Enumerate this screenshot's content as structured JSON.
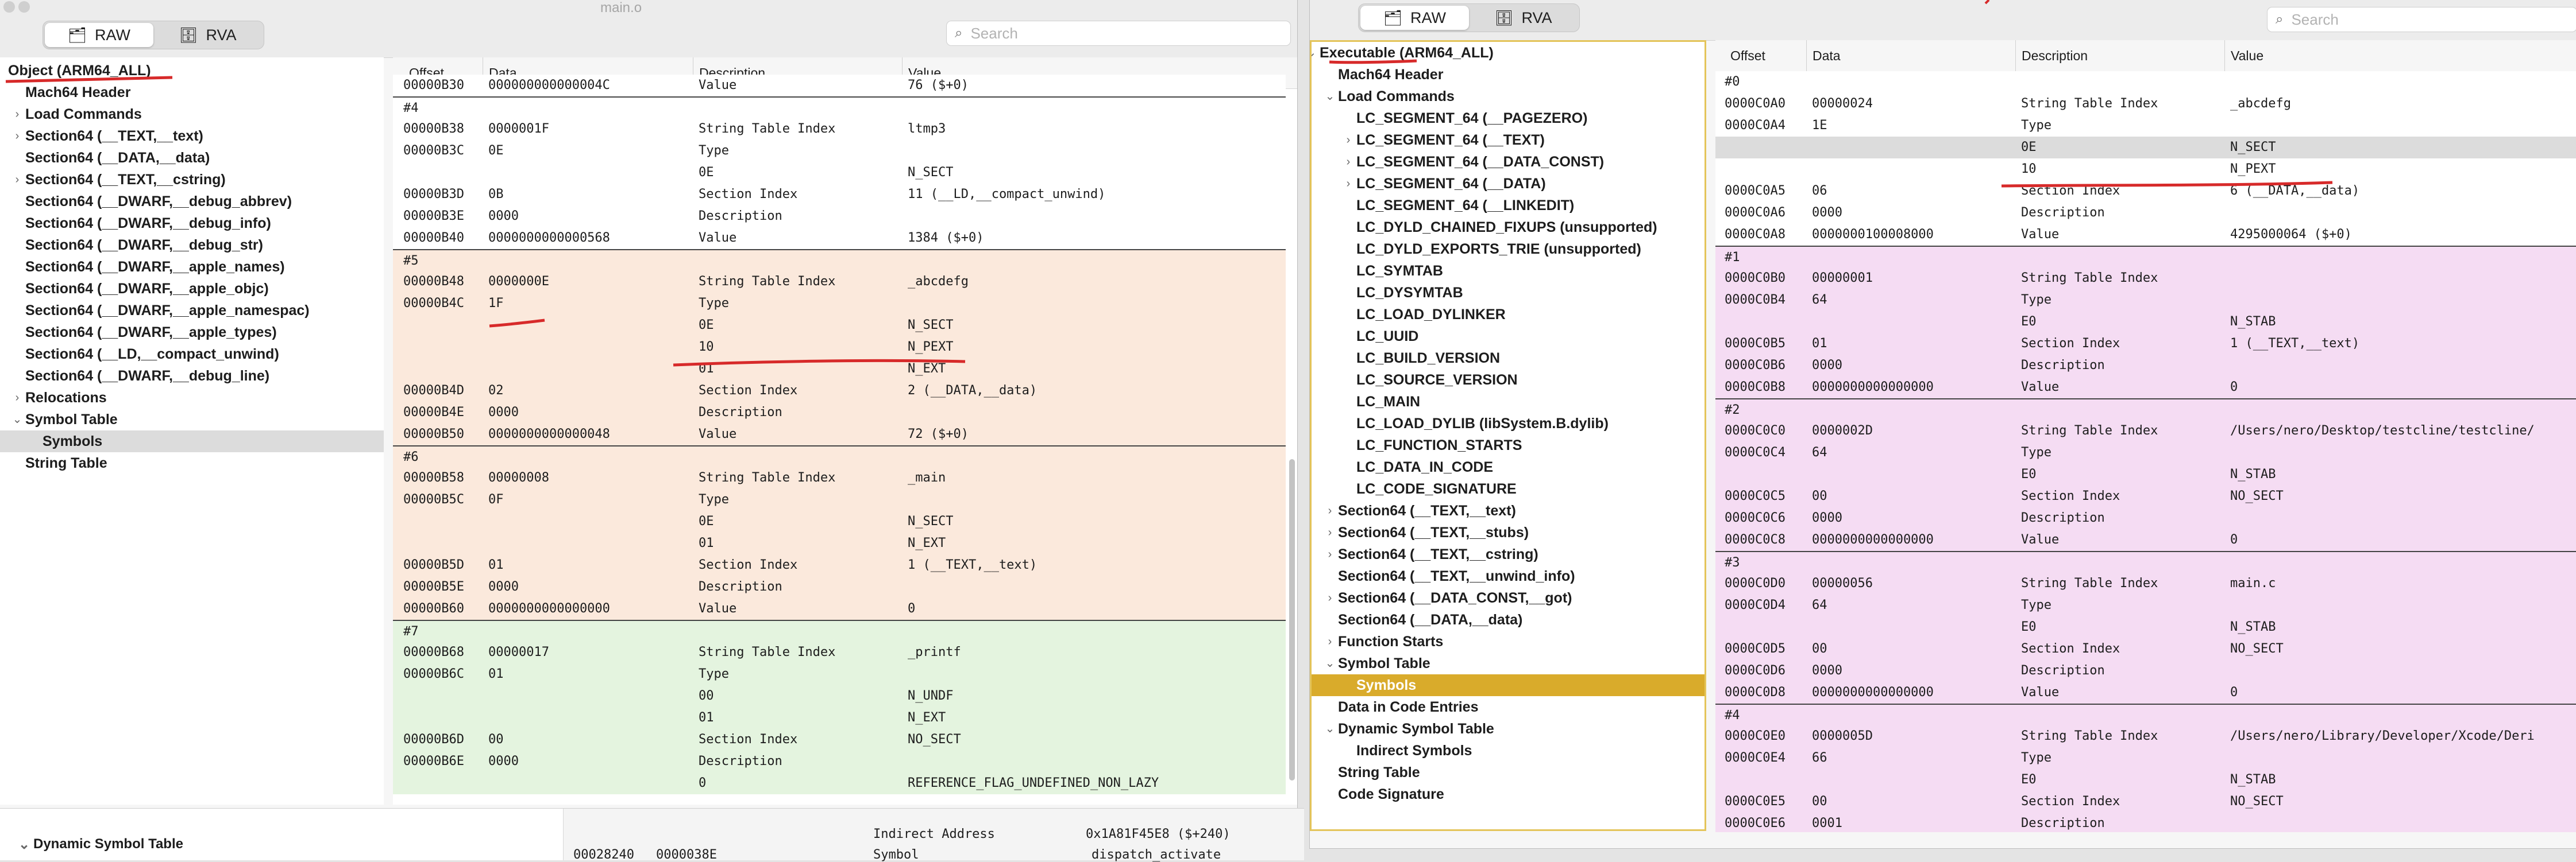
{
  "left_window": {
    "title": "main.o",
    "seg_raw": "RAW",
    "seg_rva": "RVA",
    "search_placeholder": "Search",
    "columns": {
      "offset": "Offset",
      "data": "Data",
      "description": "Description",
      "value": "Value"
    },
    "tree": [
      {
        "label": "Object (ARM64_ALL)",
        "level": 0,
        "arrow": ""
      },
      {
        "label": "Mach64 Header",
        "level": 1,
        "arrow": ""
      },
      {
        "label": "Load Commands",
        "level": 1,
        "arrow": "›"
      },
      {
        "label": "Section64 (__TEXT,__text)",
        "level": 1,
        "arrow": "›"
      },
      {
        "label": "Section64 (__DATA,__data)",
        "level": 1,
        "arrow": ""
      },
      {
        "label": "Section64 (__TEXT,__cstring)",
        "level": 1,
        "arrow": "›"
      },
      {
        "label": "Section64 (__DWARF,__debug_abbrev)",
        "level": 1,
        "arrow": ""
      },
      {
        "label": "Section64 (__DWARF,__debug_info)",
        "level": 1,
        "arrow": ""
      },
      {
        "label": "Section64 (__DWARF,__debug_str)",
        "level": 1,
        "arrow": ""
      },
      {
        "label": "Section64 (__DWARF,__apple_names)",
        "level": 1,
        "arrow": ""
      },
      {
        "label": "Section64 (__DWARF,__apple_objc)",
        "level": 1,
        "arrow": ""
      },
      {
        "label": "Section64 (__DWARF,__apple_namespac)",
        "level": 1,
        "arrow": ""
      },
      {
        "label": "Section64 (__DWARF,__apple_types)",
        "level": 1,
        "arrow": ""
      },
      {
        "label": "Section64 (__LD,__compact_unwind)",
        "level": 1,
        "arrow": ""
      },
      {
        "label": "Section64 (__DWARF,__debug_line)",
        "level": 1,
        "arrow": ""
      },
      {
        "label": "Relocations",
        "level": 1,
        "arrow": "›"
      },
      {
        "label": "Symbol Table",
        "level": 1,
        "arrow": "⌄"
      },
      {
        "label": "Symbols",
        "level": 2,
        "arrow": "",
        "selected": true
      },
      {
        "label": "String Table",
        "level": 1,
        "arrow": ""
      }
    ],
    "rows": [
      {
        "offset": "00000B30",
        "data": "000000000000004C",
        "desc": "Value",
        "value": "76 ($+0)",
        "bg": "white",
        "clip": true
      },
      {
        "offset": "#4",
        "data": "",
        "desc": "",
        "value": "",
        "bg": "white",
        "divider": true
      },
      {
        "offset": "00000B38",
        "data": "0000001F",
        "desc": "String Table Index",
        "value": "ltmp3",
        "bg": "white"
      },
      {
        "offset": "00000B3C",
        "data": "0E",
        "desc": "Type",
        "value": "",
        "bg": "white"
      },
      {
        "offset": "",
        "data": "",
        "desc": "0E",
        "value": "N_SECT",
        "bg": "white"
      },
      {
        "offset": "00000B3D",
        "data": "0B",
        "desc": "Section Index",
        "value": "11 (__LD,__compact_unwind)",
        "bg": "white"
      },
      {
        "offset": "00000B3E",
        "data": "0000",
        "desc": "Description",
        "value": "",
        "bg": "white"
      },
      {
        "offset": "00000B40",
        "data": "0000000000000568",
        "desc": "Value",
        "value": "1384 ($+0)",
        "bg": "white"
      },
      {
        "offset": "#5",
        "data": "",
        "desc": "",
        "value": "",
        "bg": "peach",
        "divider": true
      },
      {
        "offset": "00000B48",
        "data": "0000000E",
        "desc": "String Table Index",
        "value": "_abcdefg",
        "bg": "peach"
      },
      {
        "offset": "00000B4C",
        "data": "1F",
        "desc": "Type",
        "value": "",
        "bg": "peach"
      },
      {
        "offset": "",
        "data": "",
        "desc": "0E",
        "value": "N_SECT",
        "bg": "peach"
      },
      {
        "offset": "",
        "data": "",
        "desc": "10",
        "value": "N_PEXT",
        "bg": "peach"
      },
      {
        "offset": "",
        "data": "",
        "desc": "01",
        "value": "N_EXT",
        "bg": "peach"
      },
      {
        "offset": "00000B4D",
        "data": "02",
        "desc": "Section Index",
        "value": "2 (__DATA,__data)",
        "bg": "peach"
      },
      {
        "offset": "00000B4E",
        "data": "0000",
        "desc": "Description",
        "value": "",
        "bg": "peach"
      },
      {
        "offset": "00000B50",
        "data": "0000000000000048",
        "desc": "Value",
        "value": "72 ($+0)",
        "bg": "peach"
      },
      {
        "offset": "#6",
        "data": "",
        "desc": "",
        "value": "",
        "bg": "peach",
        "divider": true
      },
      {
        "offset": "00000B58",
        "data": "00000008",
        "desc": "String Table Index",
        "value": "_main",
        "bg": "peach"
      },
      {
        "offset": "00000B5C",
        "data": "0F",
        "desc": "Type",
        "value": "",
        "bg": "peach"
      },
      {
        "offset": "",
        "data": "",
        "desc": "0E",
        "value": "N_SECT",
        "bg": "peach"
      },
      {
        "offset": "",
        "data": "",
        "desc": "01",
        "value": "N_EXT",
        "bg": "peach"
      },
      {
        "offset": "00000B5D",
        "data": "01",
        "desc": "Section Index",
        "value": "1 (__TEXT,__text)",
        "bg": "peach"
      },
      {
        "offset": "00000B5E",
        "data": "0000",
        "desc": "Description",
        "value": "",
        "bg": "peach"
      },
      {
        "offset": "00000B60",
        "data": "0000000000000000",
        "desc": "Value",
        "value": "0",
        "bg": "peach"
      },
      {
        "offset": "#7",
        "data": "",
        "desc": "",
        "value": "",
        "bg": "green",
        "divider": true
      },
      {
        "offset": "00000B68",
        "data": "00000017",
        "desc": "String Table Index",
        "value": "_printf",
        "bg": "green"
      },
      {
        "offset": "00000B6C",
        "data": "01",
        "desc": "Type",
        "value": "",
        "bg": "green"
      },
      {
        "offset": "",
        "data": "",
        "desc": "00",
        "value": "N_UNDF",
        "bg": "green"
      },
      {
        "offset": "",
        "data": "",
        "desc": "01",
        "value": "N_EXT",
        "bg": "green"
      },
      {
        "offset": "00000B6D",
        "data": "00",
        "desc": "Section Index",
        "value": "NO_SECT",
        "bg": "green"
      },
      {
        "offset": "00000B6E",
        "data": "0000",
        "desc": "Description",
        "value": "",
        "bg": "green"
      },
      {
        "offset": "",
        "data": "",
        "desc": "0",
        "value": "REFERENCE_FLAG_UNDEFINED_NON_LAZY",
        "bg": "green"
      }
    ]
  },
  "background_strip": {
    "tree_label": "Dynamic Symbol Table",
    "row1_desc": "Indirect Address",
    "row1_value": "0x1A81F45E8 ($+240)",
    "row2_offset": "00028240",
    "row2_data": "0000038E",
    "row2_desc": "Symbol",
    "row2_value": "dispatch_activate"
  },
  "right_window": {
    "seg_raw": "RAW",
    "seg_rva": "RVA",
    "search_placeholder": "Search",
    "columns": {
      "offset": "Offset",
      "data": "Data",
      "description": "Description",
      "value": "Value"
    },
    "tree": [
      {
        "label": "Executable (ARM64_ALL)",
        "level": 0,
        "arrow": "⌄"
      },
      {
        "label": "Mach64 Header",
        "level": 1,
        "arrow": ""
      },
      {
        "label": "Load Commands",
        "level": 1,
        "arrow": "⌄"
      },
      {
        "label": "LC_SEGMENT_64 (__PAGEZERO)",
        "level": 2,
        "arrow": ""
      },
      {
        "label": "LC_SEGMENT_64 (__TEXT)",
        "level": 2,
        "arrow": "›"
      },
      {
        "label": "LC_SEGMENT_64 (__DATA_CONST)",
        "level": 2,
        "arrow": "›"
      },
      {
        "label": "LC_SEGMENT_64 (__DATA)",
        "level": 2,
        "arrow": "›"
      },
      {
        "label": "LC_SEGMENT_64 (__LINKEDIT)",
        "level": 2,
        "arrow": ""
      },
      {
        "label": "LC_DYLD_CHAINED_FIXUPS (unsupported)",
        "level": 2,
        "arrow": ""
      },
      {
        "label": "LC_DYLD_EXPORTS_TRIE (unsupported)",
        "level": 2,
        "arrow": ""
      },
      {
        "label": "LC_SYMTAB",
        "level": 2,
        "arrow": ""
      },
      {
        "label": "LC_DYSYMTAB",
        "level": 2,
        "arrow": ""
      },
      {
        "label": "LC_LOAD_DYLINKER",
        "level": 2,
        "arrow": ""
      },
      {
        "label": "LC_UUID",
        "level": 2,
        "arrow": ""
      },
      {
        "label": "LC_BUILD_VERSION",
        "level": 2,
        "arrow": ""
      },
      {
        "label": "LC_SOURCE_VERSION",
        "level": 2,
        "arrow": ""
      },
      {
        "label": "LC_MAIN",
        "level": 2,
        "arrow": ""
      },
      {
        "label": "LC_LOAD_DYLIB (libSystem.B.dylib)",
        "level": 2,
        "arrow": ""
      },
      {
        "label": "LC_FUNCTION_STARTS",
        "level": 2,
        "arrow": ""
      },
      {
        "label": "LC_DATA_IN_CODE",
        "level": 2,
        "arrow": ""
      },
      {
        "label": "LC_CODE_SIGNATURE",
        "level": 2,
        "arrow": ""
      },
      {
        "label": "Section64 (__TEXT,__text)",
        "level": 1,
        "arrow": "›"
      },
      {
        "label": "Section64 (__TEXT,__stubs)",
        "level": 1,
        "arrow": "›"
      },
      {
        "label": "Section64 (__TEXT,__cstring)",
        "level": 1,
        "arrow": "›"
      },
      {
        "label": "Section64 (__TEXT,__unwind_info)",
        "level": 1,
        "arrow": ""
      },
      {
        "label": "Section64 (__DATA_CONST,__got)",
        "level": 1,
        "arrow": "›"
      },
      {
        "label": "Section64 (__DATA,__data)",
        "level": 1,
        "arrow": ""
      },
      {
        "label": "Function Starts",
        "level": 1,
        "arrow": "›"
      },
      {
        "label": "Symbol Table",
        "level": 1,
        "arrow": "⌄"
      },
      {
        "label": "Symbols",
        "level": 2,
        "arrow": "",
        "selected": true
      },
      {
        "label": "Data in Code Entries",
        "level": 1,
        "arrow": ""
      },
      {
        "label": "Dynamic Symbol Table",
        "level": 1,
        "arrow": "⌄"
      },
      {
        "label": "Indirect Symbols",
        "level": 2,
        "arrow": ""
      },
      {
        "label": "String Table",
        "level": 1,
        "arrow": ""
      },
      {
        "label": "Code Signature",
        "level": 1,
        "arrow": ""
      }
    ],
    "rows": [
      {
        "offset": "#0",
        "data": "",
        "desc": "",
        "value": "",
        "bg": "white"
      },
      {
        "offset": "0000C0A0",
        "data": "00000024",
        "desc": "String Table Index",
        "value": "_abcdefg",
        "bg": "white"
      },
      {
        "offset": "0000C0A4",
        "data": "1E",
        "desc": "Type",
        "value": "",
        "bg": "white"
      },
      {
        "offset": "",
        "data": "",
        "desc": "0E",
        "value": "N_SECT",
        "bg": "gray"
      },
      {
        "offset": "",
        "data": "",
        "desc": "10",
        "value": "N_PEXT",
        "bg": "white"
      },
      {
        "offset": "0000C0A5",
        "data": "06",
        "desc": "Section Index",
        "value": "6 (__DATA,__data)",
        "bg": "white"
      },
      {
        "offset": "0000C0A6",
        "data": "0000",
        "desc": "Description",
        "value": "",
        "bg": "white"
      },
      {
        "offset": "0000C0A8",
        "data": "0000000100008000",
        "desc": "Value",
        "value": "4295000064 ($+0)",
        "bg": "white"
      },
      {
        "offset": "#1",
        "data": "",
        "desc": "",
        "value": "",
        "bg": "pink",
        "divider": true
      },
      {
        "offset": "0000C0B0",
        "data": "00000001",
        "desc": "String Table Index",
        "value": "",
        "bg": "pink"
      },
      {
        "offset": "0000C0B4",
        "data": "64",
        "desc": "Type",
        "value": "",
        "bg": "pink"
      },
      {
        "offset": "",
        "data": "",
        "desc": "E0",
        "value": "N_STAB",
        "bg": "pink"
      },
      {
        "offset": "0000C0B5",
        "data": "01",
        "desc": "Section Index",
        "value": "1 (__TEXT,__text)",
        "bg": "pink"
      },
      {
        "offset": "0000C0B6",
        "data": "0000",
        "desc": "Description",
        "value": "",
        "bg": "pink"
      },
      {
        "offset": "0000C0B8",
        "data": "0000000000000000",
        "desc": "Value",
        "value": "0",
        "bg": "pink"
      },
      {
        "offset": "#2",
        "data": "",
        "desc": "",
        "value": "",
        "bg": "pink",
        "divider": true
      },
      {
        "offset": "0000C0C0",
        "data": "0000002D",
        "desc": "String Table Index",
        "value": "/Users/nero/Desktop/testcline/testcline/",
        "bg": "pink"
      },
      {
        "offset": "0000C0C4",
        "data": "64",
        "desc": "Type",
        "value": "",
        "bg": "pink"
      },
      {
        "offset": "",
        "data": "",
        "desc": "E0",
        "value": "N_STAB",
        "bg": "pink"
      },
      {
        "offset": "0000C0C5",
        "data": "00",
        "desc": "Section Index",
        "value": "NO_SECT",
        "bg": "pink"
      },
      {
        "offset": "0000C0C6",
        "data": "0000",
        "desc": "Description",
        "value": "",
        "bg": "pink"
      },
      {
        "offset": "0000C0C8",
        "data": "0000000000000000",
        "desc": "Value",
        "value": "0",
        "bg": "pink"
      },
      {
        "offset": "#3",
        "data": "",
        "desc": "",
        "value": "",
        "bg": "pink",
        "divider": true
      },
      {
        "offset": "0000C0D0",
        "data": "00000056",
        "desc": "String Table Index",
        "value": "main.c",
        "bg": "pink"
      },
      {
        "offset": "0000C0D4",
        "data": "64",
        "desc": "Type",
        "value": "",
        "bg": "pink"
      },
      {
        "offset": "",
        "data": "",
        "desc": "E0",
        "value": "N_STAB",
        "bg": "pink"
      },
      {
        "offset": "0000C0D5",
        "data": "00",
        "desc": "Section Index",
        "value": "NO_SECT",
        "bg": "pink"
      },
      {
        "offset": "0000C0D6",
        "data": "0000",
        "desc": "Description",
        "value": "",
        "bg": "pink"
      },
      {
        "offset": "0000C0D8",
        "data": "0000000000000000",
        "desc": "Value",
        "value": "0",
        "bg": "pink"
      },
      {
        "offset": "#4",
        "data": "",
        "desc": "",
        "value": "",
        "bg": "pink",
        "divider": true
      },
      {
        "offset": "0000C0E0",
        "data": "0000005D",
        "desc": "String Table Index",
        "value": "/Users/nero/Library/Developer/Xcode/Deri",
        "bg": "pink"
      },
      {
        "offset": "0000C0E4",
        "data": "66",
        "desc": "Type",
        "value": "",
        "bg": "pink"
      },
      {
        "offset": "",
        "data": "",
        "desc": "E0",
        "value": "N_STAB",
        "bg": "pink"
      },
      {
        "offset": "0000C0E5",
        "data": "00",
        "desc": "Section Index",
        "value": "NO_SECT",
        "bg": "pink"
      },
      {
        "offset": "0000C0E6",
        "data": "0001",
        "desc": "Description",
        "value": "",
        "bg": "pink",
        "clip": true
      }
    ]
  },
  "colors": {
    "peach": "#fbe9dc",
    "green": "#e4f4df",
    "pink": "#f5dcf3",
    "gray": "#dcdcdc",
    "white": "#ffffff",
    "gold": "#d9ab2b",
    "annotation_red": "#d72a2a"
  }
}
